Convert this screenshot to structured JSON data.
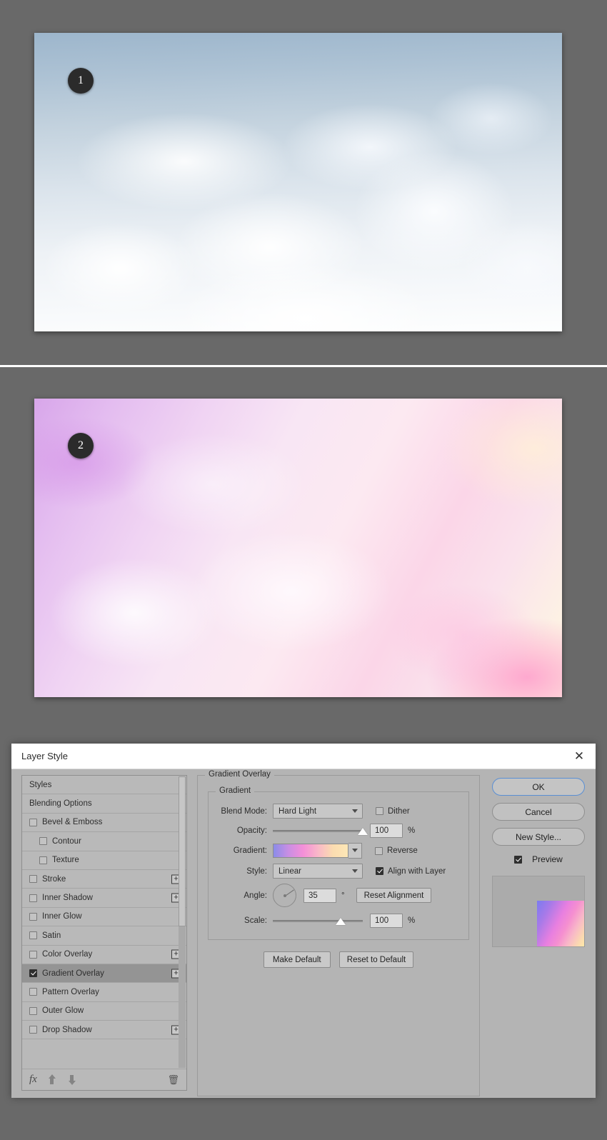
{
  "images": [
    {
      "badge": "1",
      "alt": "cloud-photo-original"
    },
    {
      "badge": "2",
      "alt": "cloud-photo-gradient-applied"
    }
  ],
  "dialog": {
    "title": "Layer Style",
    "close_icon": "close-icon",
    "styles_list": [
      {
        "label": "Styles",
        "checkbox": false,
        "checked": false,
        "indent": false,
        "plus": false,
        "selected": false
      },
      {
        "label": "Blending Options",
        "checkbox": false,
        "checked": false,
        "indent": false,
        "plus": false,
        "selected": false
      },
      {
        "label": "Bevel & Emboss",
        "checkbox": true,
        "checked": false,
        "indent": false,
        "plus": false,
        "selected": false
      },
      {
        "label": "Contour",
        "checkbox": true,
        "checked": false,
        "indent": true,
        "plus": false,
        "selected": false
      },
      {
        "label": "Texture",
        "checkbox": true,
        "checked": false,
        "indent": true,
        "plus": false,
        "selected": false
      },
      {
        "label": "Stroke",
        "checkbox": true,
        "checked": false,
        "indent": false,
        "plus": true,
        "selected": false
      },
      {
        "label": "Inner Shadow",
        "checkbox": true,
        "checked": false,
        "indent": false,
        "plus": true,
        "selected": false
      },
      {
        "label": "Inner Glow",
        "checkbox": true,
        "checked": false,
        "indent": false,
        "plus": false,
        "selected": false
      },
      {
        "label": "Satin",
        "checkbox": true,
        "checked": false,
        "indent": false,
        "plus": false,
        "selected": false
      },
      {
        "label": "Color Overlay",
        "checkbox": true,
        "checked": false,
        "indent": false,
        "plus": true,
        "selected": false
      },
      {
        "label": "Gradient Overlay",
        "checkbox": true,
        "checked": true,
        "indent": false,
        "plus": true,
        "selected": true
      },
      {
        "label": "Pattern Overlay",
        "checkbox": true,
        "checked": false,
        "indent": false,
        "plus": false,
        "selected": false
      },
      {
        "label": "Outer Glow",
        "checkbox": true,
        "checked": false,
        "indent": false,
        "plus": false,
        "selected": false
      },
      {
        "label": "Drop Shadow",
        "checkbox": true,
        "checked": false,
        "indent": false,
        "plus": true,
        "selected": false
      }
    ],
    "footer_icons": {
      "fx": "fx",
      "move_up": "arrow-up-icon",
      "move_down": "arrow-down-icon",
      "delete": "trash-icon"
    },
    "gradient_overlay": {
      "section_title": "Gradient Overlay",
      "group_title": "Gradient",
      "blend_mode_label": "Blend Mode:",
      "blend_mode_value": "Hard Light",
      "dither_label": "Dither",
      "dither_checked": false,
      "opacity_label": "Opacity:",
      "opacity_value": "100",
      "opacity_unit": "%",
      "opacity_percent": 100,
      "gradient_label": "Gradient:",
      "gradient_stops": [
        "#8a8ce8",
        "#c98ee4",
        "#f48fd8",
        "#f9b8c8",
        "#fbdcb0",
        "#fde7b6"
      ],
      "reverse_label": "Reverse",
      "reverse_checked": false,
      "style_label": "Style:",
      "style_value": "Linear",
      "align_with_layer_label": "Align with Layer",
      "align_with_layer_checked": true,
      "angle_label": "Angle:",
      "angle_value": "35",
      "angle_unit": "°",
      "reset_alignment_label": "Reset Alignment",
      "scale_label": "Scale:",
      "scale_value": "100",
      "scale_unit": "%",
      "scale_percent": 75,
      "make_default_label": "Make Default",
      "reset_to_default_label": "Reset to Default"
    },
    "actions": {
      "ok_label": "OK",
      "cancel_label": "Cancel",
      "new_style_label": "New Style...",
      "preview_label": "Preview",
      "preview_checked": true
    }
  }
}
